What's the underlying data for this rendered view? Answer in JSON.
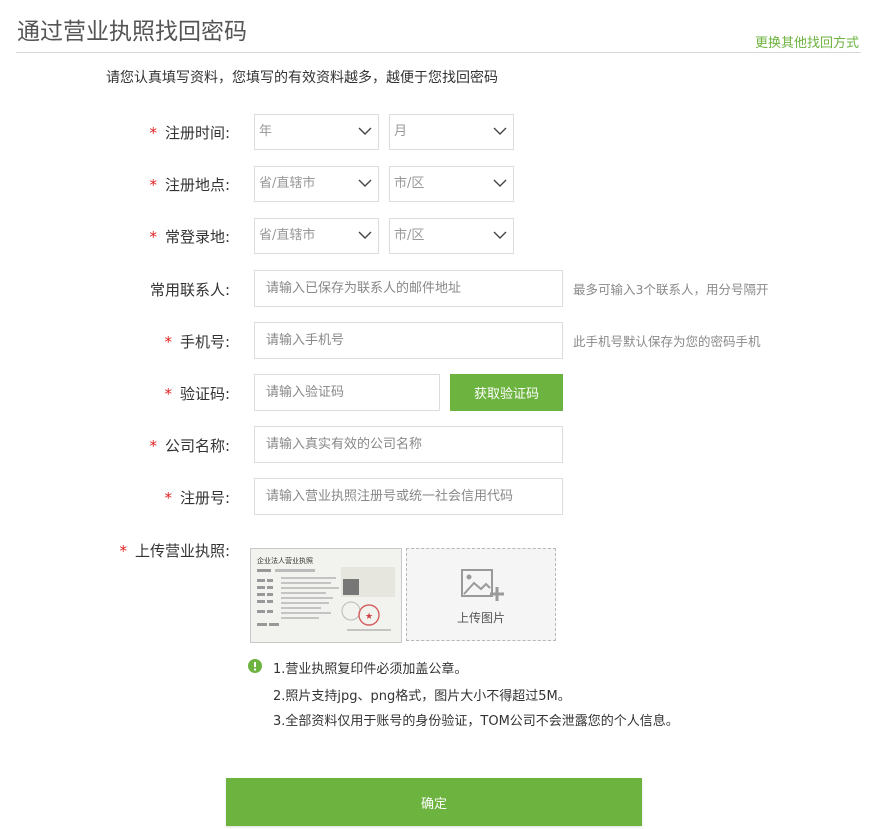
{
  "header": {
    "title": "通过营业执照找回密码",
    "switch_link": "更换其他找回方式"
  },
  "intro": "请您认真填写资料，您填写的有效资料越多，越便于您找回密码",
  "form": {
    "reg_time": {
      "label": "注册时间:",
      "year": "年",
      "month": "月"
    },
    "reg_place": {
      "label": "注册地点:",
      "province": "省/直辖市",
      "city": "市/区"
    },
    "login_place": {
      "label": "常登录地:",
      "province": "省/直辖市",
      "city": "市/区"
    },
    "contact": {
      "label": "常用联系人:",
      "placeholder": "请输入已保存为联系人的邮件地址",
      "hint": "最多可输入3个联系人，用分号隔开"
    },
    "phone": {
      "label": "手机号:",
      "placeholder": "请输入手机号",
      "hint": "此手机号默认保存为您的密码手机"
    },
    "code": {
      "label": "验证码:",
      "placeholder": "请输入验证码",
      "button": "获取验证码"
    },
    "company": {
      "label": "公司名称:",
      "placeholder": "请输入真实有效的公司名称"
    },
    "reg_no": {
      "label": "注册号:",
      "placeholder": "请输入营业执照注册号或统一社会信用代码"
    },
    "license": {
      "label": "上传营业执照:",
      "sample_title": "企业法人营业执照",
      "upload_text": "上传图片"
    }
  },
  "notes": [
    "1.营业执照复印件必须加盖公章。",
    "2.照片支持jpg、png格式，图片大小不得超过5M。",
    "3.全部资料仅用于账号的身份验证，TOM公司不会泄露您的个人信息。"
  ],
  "submit_label": "确定",
  "colors": {
    "accent": "#6db33f",
    "required": "#e02020"
  }
}
